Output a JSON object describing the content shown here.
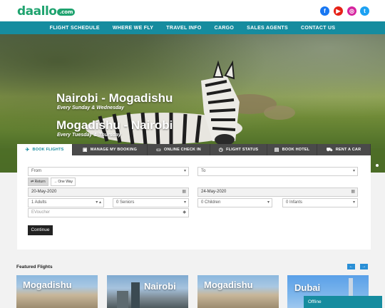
{
  "brand": {
    "logo_text": "daallo",
    "logo_tld": ".com",
    "color": "#1fa36f"
  },
  "social": [
    {
      "icon": "facebook-icon",
      "glyph": "f",
      "color": "#1877f2"
    },
    {
      "icon": "youtube-icon",
      "glyph": "▶",
      "color": "#e62117"
    },
    {
      "icon": "instagram-icon",
      "glyph": "◎",
      "color": "#d6249f"
    },
    {
      "icon": "twitter-icon",
      "glyph": "t",
      "color": "#1da1f2"
    }
  ],
  "nav": {
    "accent": "#168c9f",
    "items": [
      "FLIGHT SCHEDULE",
      "WHERE WE FLY",
      "TRAVEL INFO",
      "CARGO",
      "SALES AGENTS",
      "CONTACT US"
    ]
  },
  "hero": {
    "route1": "Nairobi - Mogadishu",
    "days1": "Every Sunday & Wednesday",
    "route2": "Mogadishu - Nairobi",
    "days2": "Every Tuesday & Thursday"
  },
  "tabs": [
    {
      "label": "BOOK FLIGHTS",
      "icon": "plane-icon",
      "glyph": "✈",
      "active": true
    },
    {
      "label": "MANAGE MY BOOKING",
      "icon": "briefcase-icon",
      "glyph": "▣",
      "active": false
    },
    {
      "label": "ONLINE CHECK IN",
      "icon": "laptop-icon",
      "glyph": "▭",
      "active": false
    },
    {
      "label": "FLIGHT STATUS",
      "icon": "clock-icon",
      "glyph": "◷",
      "active": false
    },
    {
      "label": "BOOK HOTEL",
      "icon": "hotel-icon",
      "glyph": "▤",
      "active": false
    },
    {
      "label": "RENT A CAR",
      "icon": "car-icon",
      "glyph": "⛟",
      "active": false
    }
  ],
  "booking": {
    "from": "From",
    "to": "To",
    "return_label": "Return",
    "oneway_label": "One Way",
    "depart_date": "20-May-2020",
    "return_date": "24-May-2020",
    "adults": "1 Adults",
    "seniors": "0 Seniors",
    "children": "0 Children",
    "infants": "0 Infants",
    "voucher_placeholder": "EVoucher",
    "continue_label": "Continue"
  },
  "featured": {
    "title": "Featured Flights",
    "prev": "←",
    "next": "→",
    "cards": [
      {
        "city": "Mogadishu"
      },
      {
        "city": "Nairobi"
      },
      {
        "city": "Mogadishu"
      },
      {
        "city": "Dubai"
      }
    ]
  },
  "chat": {
    "status": "Offline"
  }
}
